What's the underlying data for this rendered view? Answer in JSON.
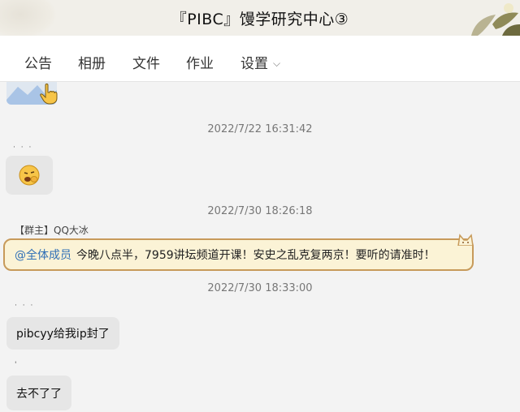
{
  "window": {
    "title": "『PIBC』馒学研究中心③"
  },
  "tabs": [
    {
      "label": "公告"
    },
    {
      "label": "相册"
    },
    {
      "label": "文件"
    },
    {
      "label": "作业"
    },
    {
      "label": "设置"
    }
  ],
  "icons": {
    "settings_dropdown": "chevron-down-icon",
    "emoji": "yawning-face-icon",
    "hand": "pointing-hand-icon"
  },
  "messages": {
    "ts1": "2022/7/22 16:31:42",
    "ts2": "2022/7/30 18:26:18",
    "sender_role": "【群主】",
    "sender_name": "QQ大冰",
    "notice_at": "@全体成员",
    "notice_text": "今晚八点半，7959讲坛频道开课！安史之乱克复两京！要听的请准时！",
    "ts3": "2022/7/30 18:33:00",
    "msg1": "pibcyy给我ip封了",
    "msg2": "去不了了"
  },
  "colors": {
    "notice_bg": "#fbf3d6",
    "notice_border": "#c79a5a",
    "mention": "#2f6fb6",
    "bubble_bg": "#e6e6e6"
  }
}
